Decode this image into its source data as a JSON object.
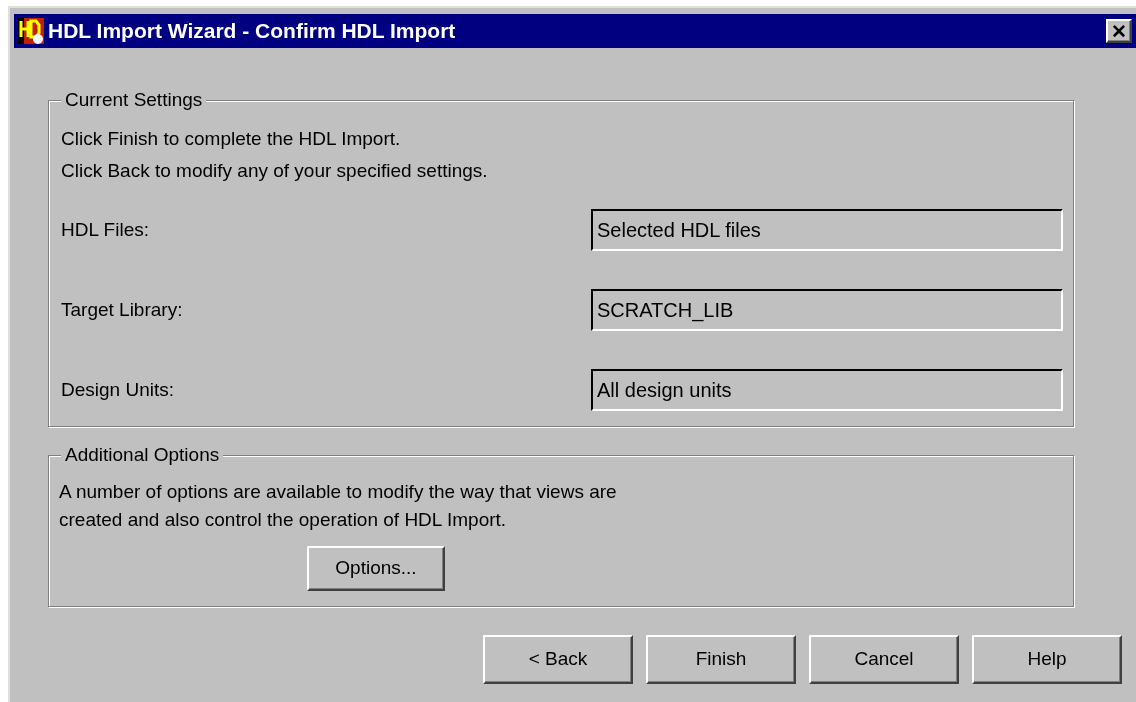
{
  "window": {
    "title": "HDL Import Wizard - Confirm HDL Import",
    "close": "✕"
  },
  "current_settings": {
    "legend": "Current Settings",
    "lines": [
      "Click Finish to complete the HDL Import.",
      "Click Back to modify any of your specified settings."
    ],
    "fields": [
      {
        "label": "HDL Files:",
        "value": "Selected HDL files"
      },
      {
        "label": "Target Library:",
        "value": "SCRATCH_LIB"
      },
      {
        "label": "Design Units:",
        "value": "All design units"
      }
    ]
  },
  "additional_options": {
    "legend": "Additional Options",
    "lines": [
      "A number of options are available to modify the way that views are",
      "created and also control the operation of HDL Import."
    ],
    "button": "Options..."
  },
  "buttons": [
    "< Back",
    "Finish",
    "Cancel",
    "Help"
  ]
}
